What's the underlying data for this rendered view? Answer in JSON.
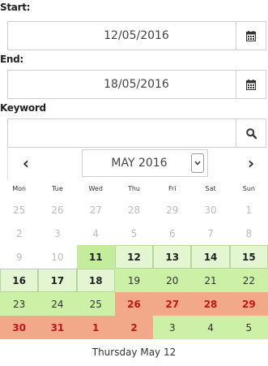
{
  "form": {
    "start_label": "Start:",
    "start_value": "12/05/2016",
    "end_label": "End:",
    "end_value": "18/05/2016",
    "keyword_label": "Keyword",
    "keyword_value": ""
  },
  "calendar": {
    "prev": "‹",
    "next": "›",
    "month_select": "MAY 2016",
    "weekdays": [
      "Mon",
      "Tue",
      "Wed",
      "Thu",
      "Fri",
      "Sat",
      "Sun"
    ],
    "days": [
      {
        "d": "25",
        "s": "muted"
      },
      {
        "d": "26",
        "s": "muted"
      },
      {
        "d": "27",
        "s": "muted"
      },
      {
        "d": "28",
        "s": "muted"
      },
      {
        "d": "29",
        "s": "muted"
      },
      {
        "d": "30",
        "s": "muted"
      },
      {
        "d": "1",
        "s": "muted"
      },
      {
        "d": "2",
        "s": "muted"
      },
      {
        "d": "3",
        "s": "muted"
      },
      {
        "d": "4",
        "s": "muted"
      },
      {
        "d": "5",
        "s": "muted"
      },
      {
        "d": "6",
        "s": "muted"
      },
      {
        "d": "7",
        "s": "muted"
      },
      {
        "d": "8",
        "s": "muted"
      },
      {
        "d": "9",
        "s": "muted"
      },
      {
        "d": "10",
        "s": "muted"
      },
      {
        "d": "11",
        "s": "green-bold"
      },
      {
        "d": "12",
        "s": "range"
      },
      {
        "d": "13",
        "s": "range"
      },
      {
        "d": "14",
        "s": "range"
      },
      {
        "d": "15",
        "s": "range"
      },
      {
        "d": "16",
        "s": "range"
      },
      {
        "d": "17",
        "s": "range"
      },
      {
        "d": "18",
        "s": "range-plain"
      },
      {
        "d": "19",
        "s": "avail"
      },
      {
        "d": "20",
        "s": "avail"
      },
      {
        "d": "21",
        "s": "avail"
      },
      {
        "d": "22",
        "s": "avail"
      },
      {
        "d": "23",
        "s": "avail"
      },
      {
        "d": "24",
        "s": "avail"
      },
      {
        "d": "25",
        "s": "avail"
      },
      {
        "d": "26",
        "s": "busy"
      },
      {
        "d": "27",
        "s": "busy"
      },
      {
        "d": "28",
        "s": "busy"
      },
      {
        "d": "29",
        "s": "busy"
      },
      {
        "d": "30",
        "s": "busy"
      },
      {
        "d": "31",
        "s": "busy"
      },
      {
        "d": "1",
        "s": "busy"
      },
      {
        "d": "2",
        "s": "busy"
      },
      {
        "d": "3",
        "s": "avail"
      },
      {
        "d": "4",
        "s": "avail"
      },
      {
        "d": "5",
        "s": "avail"
      }
    ],
    "selected_date_text": "Thursday May 12"
  },
  "icons": {
    "calendar": "calendar-icon",
    "search": "search-icon"
  },
  "colors": {
    "available": "#ccf0a6",
    "booked": "#f2a98a",
    "booked_text": "#c0151a"
  }
}
